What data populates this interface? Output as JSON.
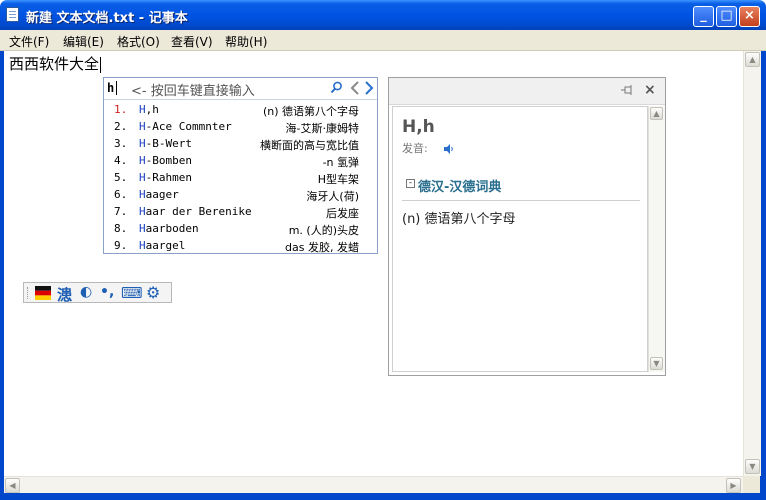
{
  "window": {
    "title": "新建 文本文档.txt - 记事本",
    "minimize_glyph": "_",
    "maximize_glyph": "□",
    "close_glyph": "×"
  },
  "menu": [
    {
      "label": "文件(F)"
    },
    {
      "label": "编辑(E)"
    },
    {
      "label": "格式(O)"
    },
    {
      "label": "查看(V)"
    },
    {
      "label": "帮助(H)"
    }
  ],
  "editor": {
    "text": "西西软件大全"
  },
  "ime": {
    "typed": "h",
    "hint": "<- 按回车键直接输入",
    "candidates": [
      {
        "num": "1.",
        "prefix": "H",
        "rest": ",h",
        "def": "(n) 德语第八个字母"
      },
      {
        "num": "2.",
        "prefix": "H",
        "rest": "-Ace Commnter",
        "def": "海-艾斯·康姆特"
      },
      {
        "num": "3.",
        "prefix": "H",
        "rest": "-B-Wert",
        "def": "横断面的高与宽比值"
      },
      {
        "num": "4.",
        "prefix": "H",
        "rest": "-Bomben",
        "def": "-n 氢弹"
      },
      {
        "num": "5.",
        "prefix": "H",
        "rest": "-Rahmen",
        "def": "H型车架"
      },
      {
        "num": "6.",
        "prefix": "H",
        "rest": "aager",
        "def": "海牙人(荷)"
      },
      {
        "num": "7.",
        "prefix": "H",
        "rest": "aar der Berenike",
        "def": "后发座"
      },
      {
        "num": "8.",
        "prefix": "H",
        "rest": "aarboden",
        "def": "m. (人的)头皮"
      },
      {
        "num": "9.",
        "prefix": "H",
        "rest": "aargel",
        "def": "das 发胶, 发蜡"
      }
    ]
  },
  "dictionary": {
    "headword": "H,h",
    "pronunciation_label": "发音:",
    "section_toggle": "-",
    "section_title": "德汉-汉德词典",
    "definition": "(n) 德语第八个字母",
    "close_glyph": "×"
  },
  "toolbar": {
    "tools": [
      {
        "glyph": "漶"
      },
      {
        "glyph": "◐"
      },
      {
        "glyph": "•,"
      },
      {
        "glyph": "⌨"
      },
      {
        "glyph": "⚙"
      }
    ]
  },
  "colors": {
    "title_bar": "#0054e3",
    "menu_bg": "#ece9d8",
    "ime_highlight": "#1a3fc0",
    "ime_first_number": "#d02020",
    "dict_section": "#2a6f8f"
  }
}
